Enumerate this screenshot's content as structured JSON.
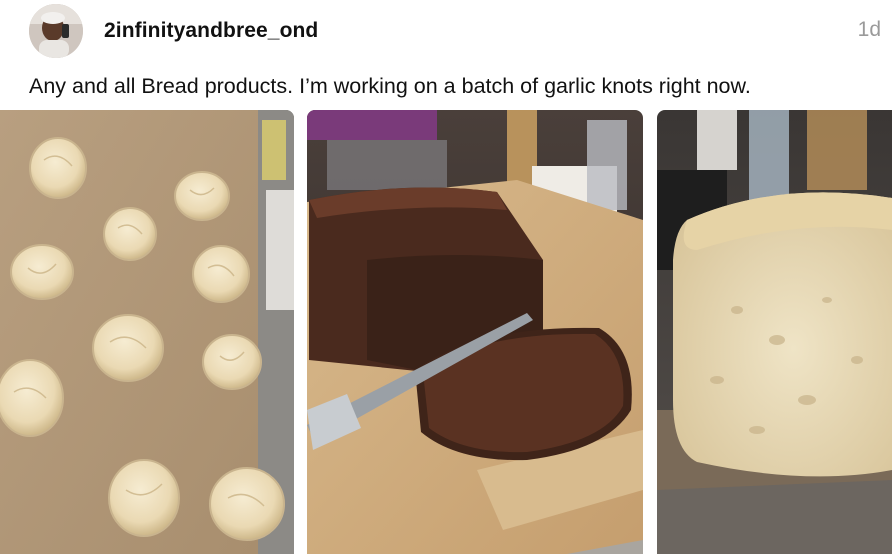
{
  "post": {
    "username": "2infinityandbree_ond",
    "time": "1d",
    "caption": "Any and all Bread products. I’m working on a batch of garlic knots right now."
  },
  "photos": [
    {
      "subject": "raw garlic knots on parchment baking sheet"
    },
    {
      "subject": "sliced chocolate loaf on parchment with knife"
    },
    {
      "subject": "crusty white bread loaf"
    }
  ]
}
